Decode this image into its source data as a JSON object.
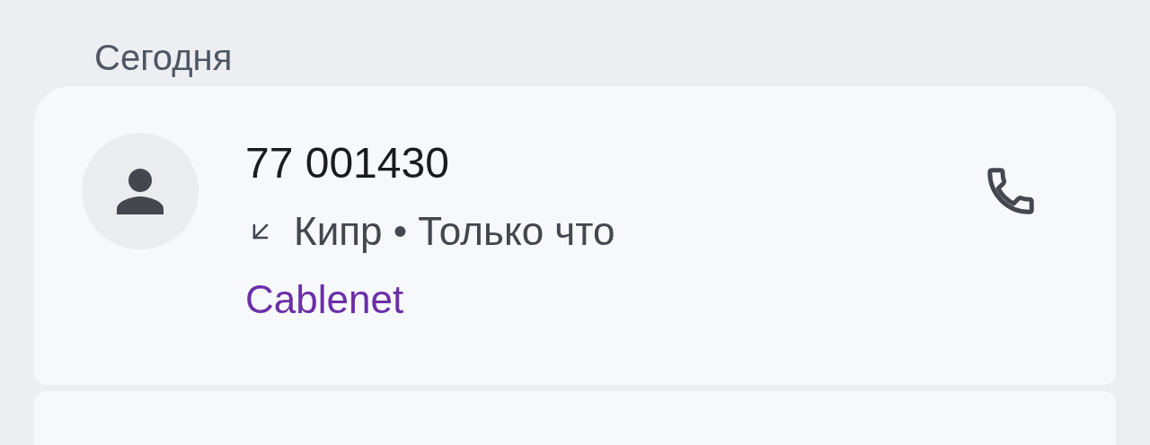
{
  "section_title": "Сегодня",
  "calls": [
    {
      "number": "77 001430",
      "details": "Кипр • Только что",
      "carrier": "Cablenet"
    }
  ]
}
